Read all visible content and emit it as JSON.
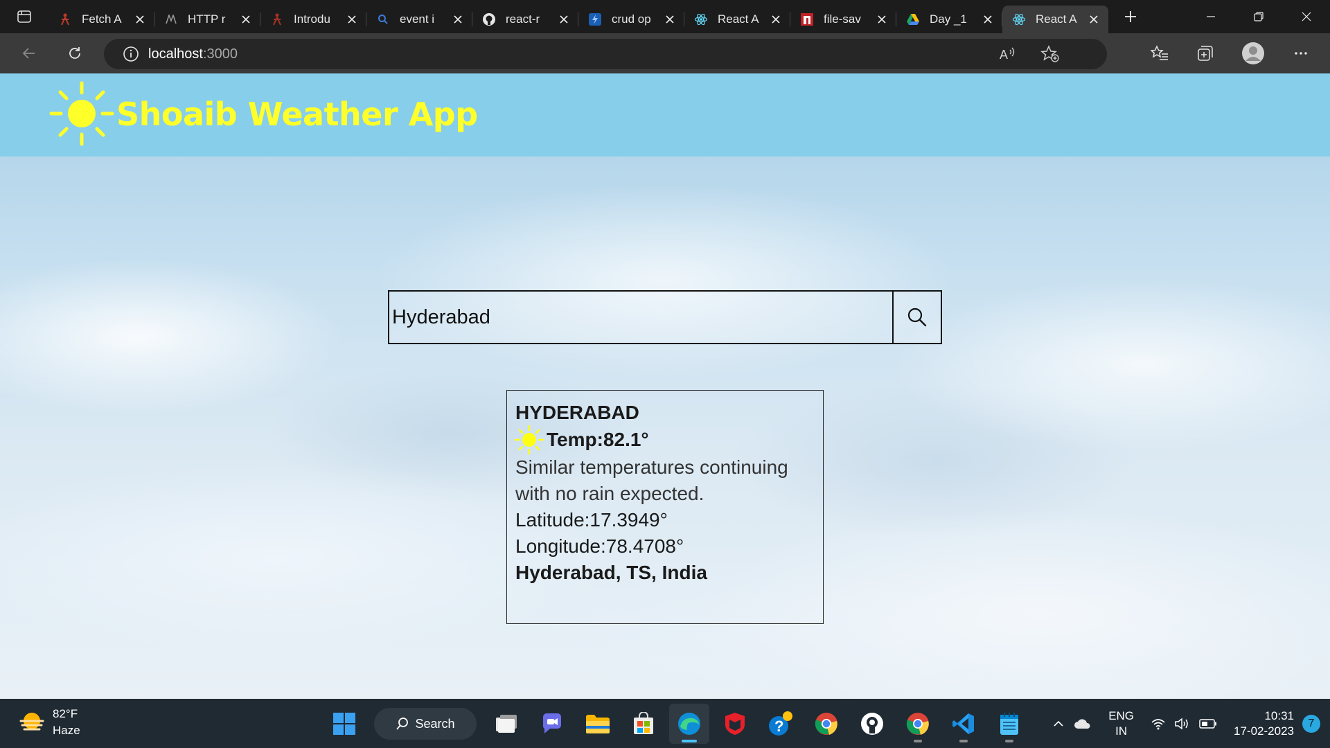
{
  "browser": {
    "tabs": [
      {
        "title": "Fetch A",
        "favicon": "red-figure-icon",
        "active": false
      },
      {
        "title": "HTTP r",
        "favicon": "m-logo-icon",
        "active": false
      },
      {
        "title": "Introdu",
        "favicon": "red-figure-icon",
        "active": false
      },
      {
        "title": "event i",
        "favicon": "search-icon",
        "active": false
      },
      {
        "title": "react-r",
        "favicon": "github-icon",
        "active": false
      },
      {
        "title": "crud op",
        "favicon": "stackblitz-icon",
        "active": false
      },
      {
        "title": "React A",
        "favicon": "react-icon",
        "active": false
      },
      {
        "title": "file-sav",
        "favicon": "npm-icon",
        "active": false
      },
      {
        "title": "Day _1",
        "favicon": "google-drive-icon",
        "active": false
      },
      {
        "title": "React A",
        "favicon": "react-icon",
        "active": true
      }
    ],
    "address": {
      "host": "localhost",
      "port": ":3000"
    }
  },
  "app": {
    "title": "Shoaib Weather App",
    "search": {
      "value": "Hyderabad",
      "placeholder": ""
    },
    "result": {
      "city": "HYDERABAD",
      "temp": "Temp:82.1°",
      "description": "Similar temperatures continuing with no rain expected.",
      "latitude": "Latitude:17.3949°",
      "longitude": "Longitude:78.4708°",
      "location": "Hyderabad, TS, India"
    }
  },
  "taskbar": {
    "weather": {
      "temp": "82°F",
      "condition": "Haze"
    },
    "search_label": "Search",
    "language": {
      "line1": "ENG",
      "line2": "IN"
    },
    "clock": {
      "time": "10:31",
      "date": "17-02-2023"
    },
    "notifications": "7"
  },
  "colors": {
    "header_bg": "#87ceeb",
    "title_yellow": "#ffff2a",
    "taskbar_bg": "#1f2a33",
    "accent": "#4cc2ff"
  }
}
